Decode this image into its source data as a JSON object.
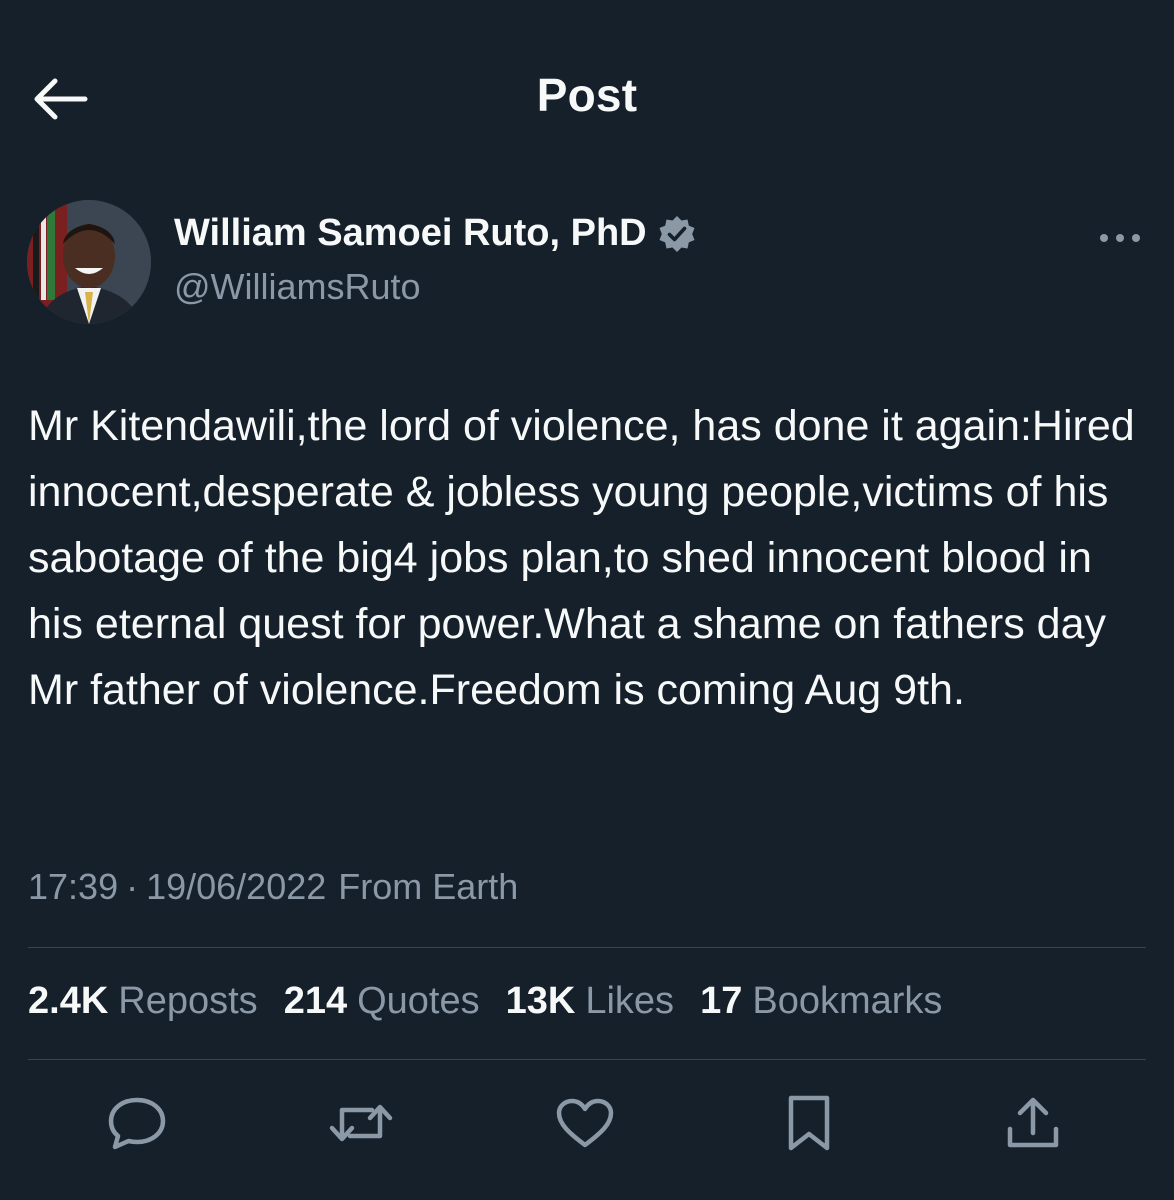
{
  "header": {
    "title": "Post",
    "back_icon": "arrow-left-icon"
  },
  "author": {
    "name": "William Samoei Ruto, PhD",
    "handle": "@WilliamsRuto",
    "verified": true,
    "verified_color": "#8b98a5"
  },
  "post": {
    "text": "Mr Kitendawili,the lord of violence, has done it again:Hired innocent,desperate & jobless young people,victims of his sabotage of the big4 jobs plan,to shed innocent blood in his eternal quest for power.What a shame on fathers day Mr father of violence.Freedom is coming Aug 9th.",
    "time": "17:39",
    "separator": "·",
    "date": "19/06/2022",
    "source": "From Earth"
  },
  "stats": {
    "reposts": {
      "count": "2.4K",
      "label": "Reposts"
    },
    "quotes": {
      "count": "214",
      "label": "Quotes"
    },
    "likes": {
      "count": "13K",
      "label": "Likes"
    },
    "bookmarks": {
      "count": "17",
      "label": "Bookmarks"
    }
  },
  "actions": [
    "reply-icon",
    "repost-icon",
    "like-icon",
    "bookmark-icon",
    "share-icon"
  ],
  "colors": {
    "background": "#15202b",
    "primary_text": "#f7f9f9",
    "secondary_text": "#8b98a5",
    "divider": "#38444d"
  }
}
